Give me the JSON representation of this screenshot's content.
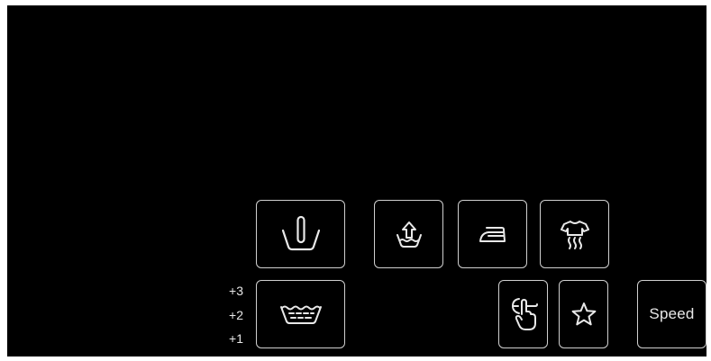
{
  "panel": {
    "background": "#000000",
    "foreground": "#e8e8e8"
  },
  "buttons": {
    "prewash": {
      "icon": "prewash-tub-icon"
    },
    "rinse_plus": {
      "icon": "rinse-extra-icon"
    },
    "easy_iron": {
      "icon": "iron-icon"
    },
    "steam": {
      "icon": "steam-shirt-icon"
    },
    "water_plus": {
      "icon": "water-level-tub-icon"
    },
    "silent": {
      "icon": "silent-finger-icon"
    },
    "favorite": {
      "icon": "star-icon"
    },
    "speed": {
      "label": "Speed"
    }
  },
  "water_levels": [
    "+3",
    "+2",
    "+1"
  ]
}
